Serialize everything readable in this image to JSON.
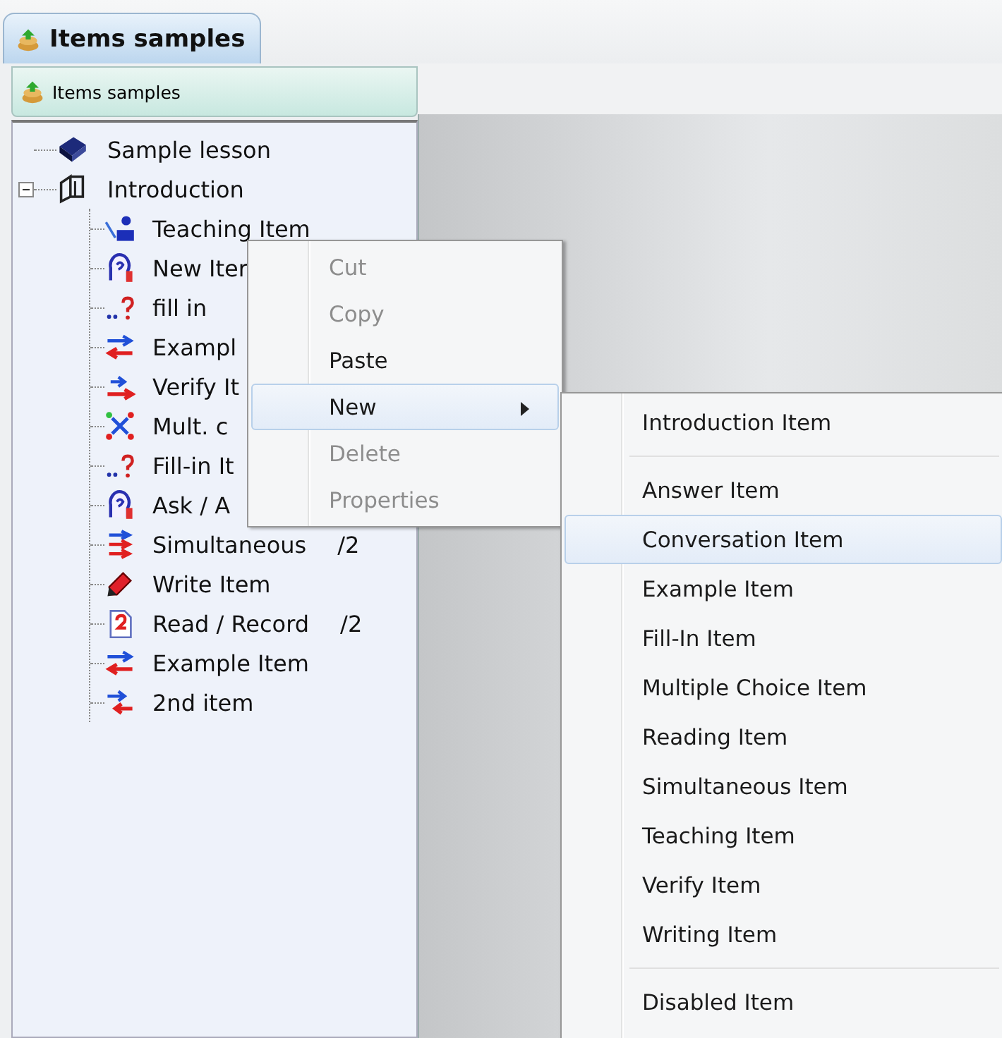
{
  "tab": {
    "label": "Items samples",
    "selected": true
  },
  "panel_header": {
    "label": "Items samples"
  },
  "tree": [
    {
      "label": "Sample lesson",
      "kind": "book"
    },
    {
      "label": "Introduction",
      "kind": "doors",
      "expanded": true,
      "children": [
        {
          "label": "Teaching Item",
          "kind": "teacher"
        },
        {
          "label": "New Iter",
          "kind": "head"
        },
        {
          "label": "fill in",
          "kind": "fillin"
        },
        {
          "label": "Exampl",
          "kind": "example"
        },
        {
          "label": "Verify It",
          "kind": "verify"
        },
        {
          "label": "Mult. c",
          "kind": "choice"
        },
        {
          "label": "Fill-in It",
          "kind": "fillin"
        },
        {
          "label": "Ask / A",
          "kind": "head"
        },
        {
          "label": "Simultaneous",
          "kind": "simul",
          "count": "/2"
        },
        {
          "label": "Write Item",
          "kind": "pencil"
        },
        {
          "label": "Read / Record",
          "kind": "read",
          "count": "/2"
        },
        {
          "label": "Example Item",
          "kind": "example"
        },
        {
          "label": "2nd item",
          "kind": "second"
        }
      ]
    }
  ],
  "context_menu": [
    {
      "label": "Cut",
      "disabled": true,
      "selected": false
    },
    {
      "label": "Copy",
      "disabled": true,
      "selected": false
    },
    {
      "label": "Paste",
      "disabled": false,
      "selected": false
    },
    {
      "label": "New",
      "disabled": false,
      "selected": true,
      "submenu": true
    },
    {
      "label": "Delete",
      "disabled": true,
      "selected": false
    },
    {
      "label": "Properties",
      "disabled": true,
      "selected": false
    }
  ],
  "submenu": [
    {
      "label": "Introduction Item",
      "selected": false
    },
    {
      "label": "Answer Item",
      "selected": false,
      "separator_before": true
    },
    {
      "label": "Conversation Item",
      "selected": true
    },
    {
      "label": "Example Item",
      "selected": false
    },
    {
      "label": "Fill-In Item",
      "selected": false
    },
    {
      "label": "Multiple Choice Item",
      "selected": false
    },
    {
      "label": "Reading Item",
      "selected": false
    },
    {
      "label": "Simultaneous Item",
      "selected": false
    },
    {
      "label": "Teaching Item",
      "selected": false
    },
    {
      "label": "Verify Item",
      "selected": false
    },
    {
      "label": "Writing Item",
      "selected": false
    },
    {
      "label": "Disabled Item",
      "selected": false,
      "separator_before": true
    }
  ]
}
